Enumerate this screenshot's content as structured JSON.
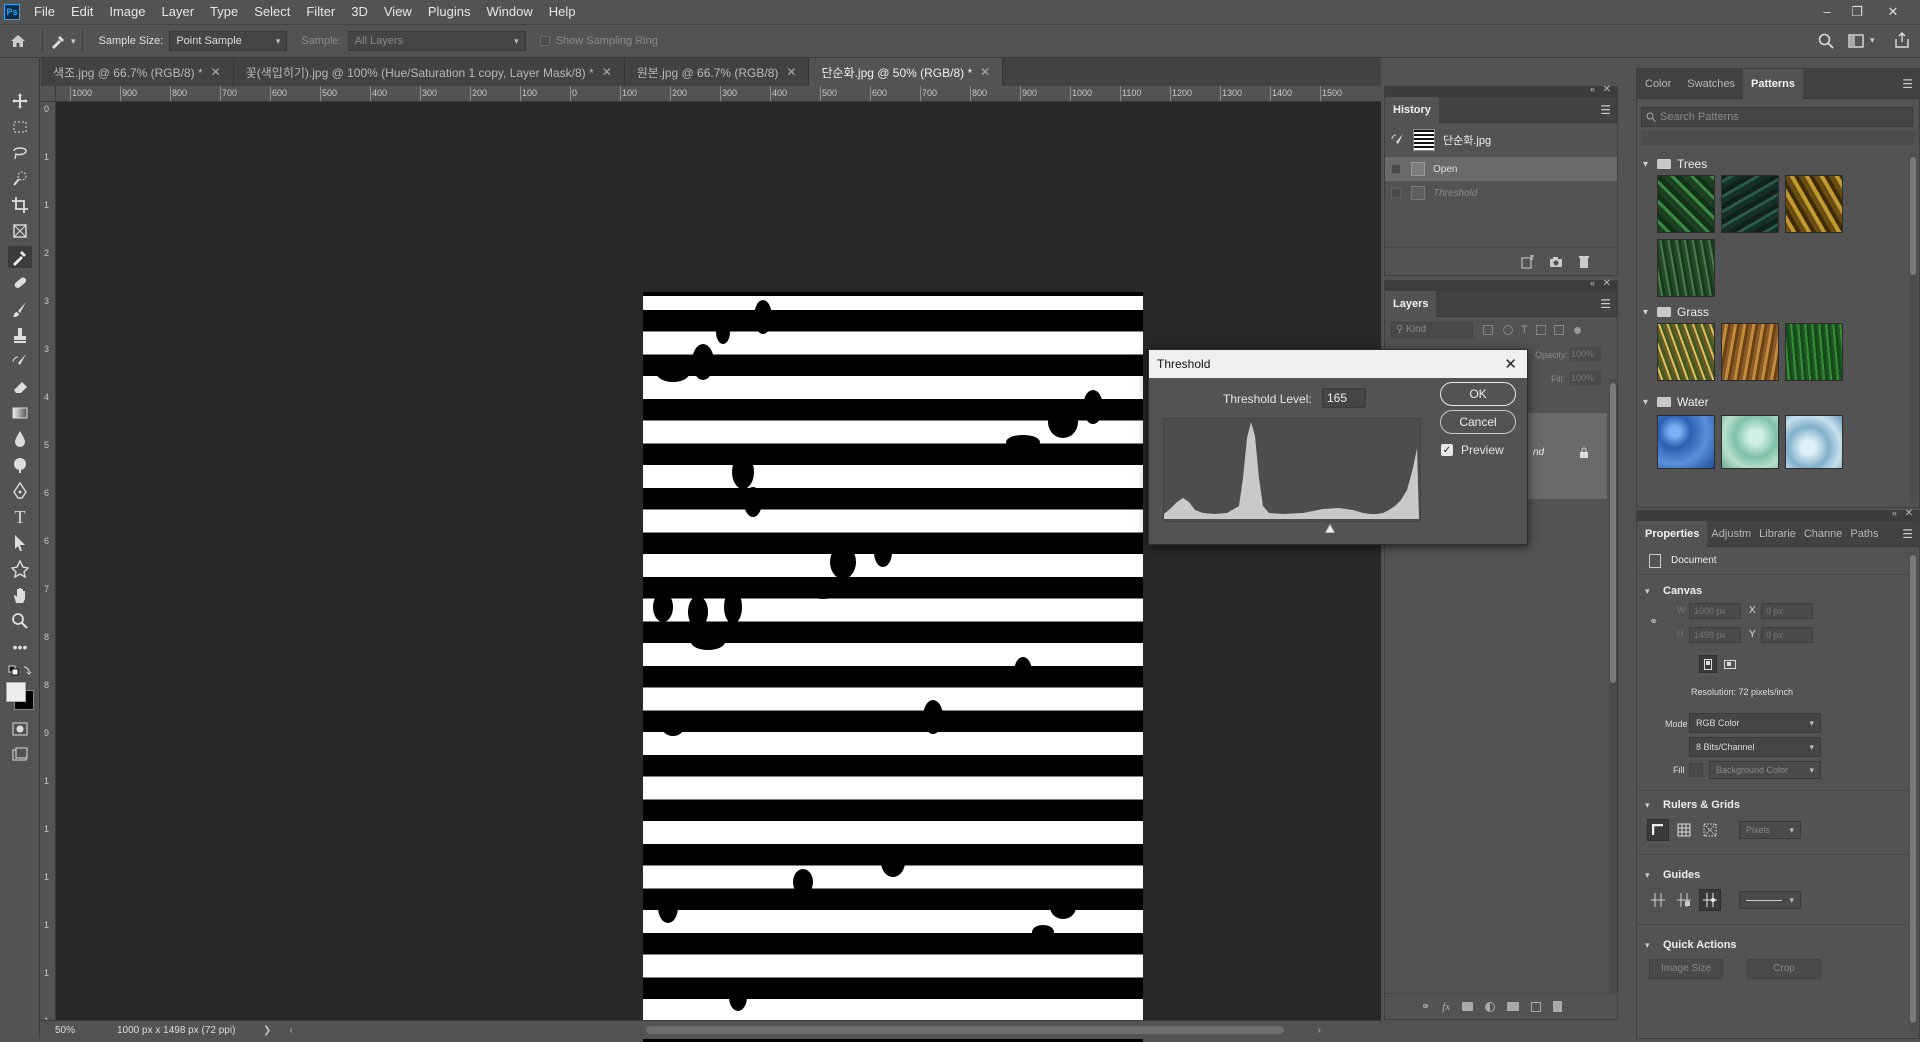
{
  "app": {
    "logo": "Ps",
    "menu": [
      "File",
      "Edit",
      "Image",
      "Layer",
      "Type",
      "Select",
      "Filter",
      "3D",
      "View",
      "Plugins",
      "Window",
      "Help"
    ]
  },
  "options_bar": {
    "sample_size_label": "Sample Size:",
    "sample_size_value": "Point Sample",
    "sample_label": "Sample:",
    "sample_value": "All Layers",
    "show_sampling_ring": "Show Sampling Ring"
  },
  "doc_tabs": [
    {
      "label": "색조.jpg @ 66.7% (RGB/8) *",
      "active": false
    },
    {
      "label": "꽃(색입히기).jpg @ 100% (Hue/Saturation 1 copy, Layer Mask/8) *",
      "active": false
    },
    {
      "label": "원본.jpg @ 66.7% (RGB/8)",
      "active": false
    },
    {
      "label": "단순화.jpg @ 50% (RGB/8) *",
      "active": true
    }
  ],
  "ruler": {
    "top_labels": [
      "1000",
      "900",
      "800",
      "700",
      "600",
      "500",
      "400",
      "300",
      "200",
      "100",
      "0",
      "100",
      "200",
      "300",
      "400",
      "500",
      "600",
      "700",
      "800",
      "900",
      "1000",
      "1100",
      "1200",
      "1300",
      "1400",
      "1500"
    ],
    "left_labels": [
      "0",
      "1",
      "1",
      "2",
      "3",
      "3",
      "4",
      "5",
      "6",
      "6",
      "7",
      "8",
      "8",
      "9",
      "1",
      "1",
      "1",
      "1",
      "1",
      "1"
    ]
  },
  "status": {
    "zoom": "50%",
    "doc_info": "1000 px x 1498 px (72 ppi)",
    "arrow": "❯"
  },
  "history_panel": {
    "title": "History",
    "snapshot": "단순화.jpg",
    "items": [
      {
        "label": "Open",
        "selected": true
      },
      {
        "label": "Threshold",
        "selected": false
      }
    ]
  },
  "layers_panel": {
    "title": "Layers",
    "kind_placeholder": "Kind",
    "opacity_label": "Opacity:",
    "opacity_value": "100%",
    "fill_label": "Fill:",
    "fill_value": "100%",
    "layer_name_fragment": "nd"
  },
  "patterns_panel": {
    "tabs": [
      "Color",
      "Swatches",
      "Patterns"
    ],
    "active_tab": "Patterns",
    "search_placeholder": "Search Patterns",
    "folders": [
      {
        "name": "Trees",
        "swatches": [
          "#1f4a26",
          "#1c3a30",
          "#8a6a1c",
          "#2f5a34"
        ]
      },
      {
        "name": "Grass",
        "swatches": [
          "#9a8430",
          "#9a6a2c",
          "#2e6a2e"
        ]
      },
      {
        "name": "Water",
        "swatches": [
          "#3c78c0",
          "#8cc8b4",
          "#8cb4cc"
        ]
      }
    ]
  },
  "properties_panel": {
    "tabs": [
      "Properties",
      "Adjustm",
      "Librarie",
      "Channe",
      "Paths"
    ],
    "active_tab": "Properties",
    "doc_label": "Document",
    "canvas_heading": "Canvas",
    "w_label": "W",
    "w_value": "1000 px",
    "h_label": "H",
    "h_value": "1498 px",
    "x_label": "X",
    "x_value": "0 px",
    "y_label": "Y",
    "y_value": "0 px",
    "resolution": "Resolution: 72 pixels/inch",
    "mode_label": "Mode",
    "mode_value": "RGB Color",
    "depth_value": "8 Bits/Channel",
    "fill_label": "Fill",
    "fill_value": "Background Color",
    "rulers_heading": "Rulers & Grids",
    "units_value": "Pixels",
    "guides_heading": "Guides",
    "quick_actions_heading": "Quick Actions",
    "qa_image_size": "Image Size",
    "qa_crop": "Crop"
  },
  "threshold_dialog": {
    "title": "Threshold",
    "level_label": "Threshold Level:",
    "level_value": "165",
    "level_fraction": 0.647,
    "ok": "OK",
    "cancel": "Cancel",
    "preview": "Preview",
    "preview_checked": true
  }
}
